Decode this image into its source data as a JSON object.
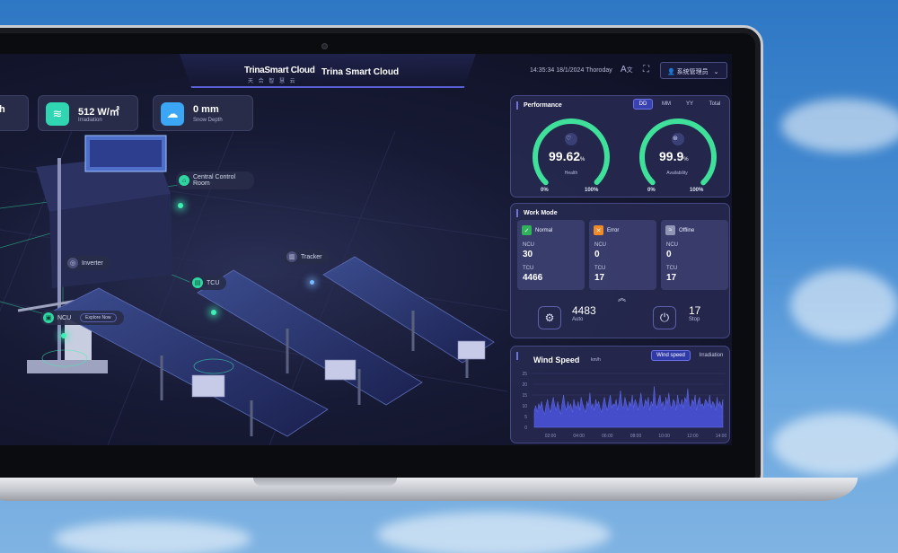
{
  "header": {
    "logo_text": "TrinaSmart Cloud",
    "logo_sub": "天 合 智 慧 云",
    "title": "Trina Smart Cloud",
    "datetime": "14:35:34 18/1/2024 Thoroday",
    "user": "系统管理员",
    "icons": [
      "translate-icon",
      "fullscreen-icon",
      "user-icon",
      "chevron-down-icon"
    ]
  },
  "stats": [
    {
      "value": "h",
      "label": ""
    },
    {
      "value": "512 W/㎡",
      "label": "Irradiation",
      "color": "#2fd6b1"
    },
    {
      "value": "0 mm",
      "label": "Snow Depth",
      "color": "#3aa6f5"
    }
  ],
  "scene": {
    "central": "Central Control Room",
    "inverter": "Inverter",
    "tracker": "Tracker",
    "tcu": "TCU",
    "ncu": "NCU",
    "explore": "Explore Now"
  },
  "performance": {
    "title": "Performance",
    "tabs": [
      "DD",
      "MM",
      "YY",
      "Total"
    ],
    "active_tab": "DD",
    "gauges": [
      {
        "value": "99.62",
        "unit": "%",
        "label": "Health",
        "min": "0%",
        "max": "100%",
        "fraction": 0.9962
      },
      {
        "value": "99.9",
        "unit": "%",
        "label": "Availability",
        "min": "0%",
        "max": "100%",
        "fraction": 0.999
      }
    ]
  },
  "work_mode": {
    "title": "Work Mode",
    "cards": [
      {
        "name": "Normal",
        "color": "#2fb35a",
        "ncu_label": "NCU",
        "ncu": "30",
        "tcu_label": "TCU",
        "tcu": "4466"
      },
      {
        "name": "Error",
        "color": "#f08a26",
        "ncu_label": "NCU",
        "ncu": "0",
        "tcu_label": "TCU",
        "tcu": "17"
      },
      {
        "name": "Offline",
        "color": "#8f95b5",
        "ncu_label": "NCU",
        "ncu": "0",
        "tcu_label": "TCU",
        "tcu": "17"
      }
    ],
    "auto_value": "4483",
    "auto_label": "Auto",
    "stop_value": "17",
    "stop_label": "Stop"
  },
  "wind": {
    "title": "Wind Speed",
    "unit": "km/h",
    "tabs": [
      "Wind speed",
      "Irradiation"
    ],
    "active_tab": "Wind speed"
  },
  "chart_data": {
    "type": "area",
    "title": "Wind Speed",
    "ylabel": "km/h",
    "ylim": [
      0,
      25
    ],
    "yticks": [
      0,
      5,
      10,
      15,
      20,
      25
    ],
    "xticks": [
      "02:00",
      "04:00",
      "06:00",
      "08:00",
      "10:00",
      "12:00",
      "14:00"
    ],
    "series": [
      {
        "color": "#4b55e0",
        "values": [
          8,
          10,
          7,
          11,
          9,
          12,
          8,
          6,
          10,
          13,
          9,
          7,
          11,
          14,
          10,
          8,
          12,
          9,
          6,
          11,
          15,
          10,
          8,
          12,
          9,
          11,
          7,
          13,
          10,
          9,
          12,
          8,
          14,
          11,
          9,
          7,
          12,
          10,
          16,
          9,
          11,
          8,
          13,
          10,
          12,
          9,
          7,
          11,
          14,
          10,
          8,
          12,
          15,
          9,
          11,
          10,
          13,
          8,
          12,
          17,
          10,
          9,
          14,
          11,
          8,
          12,
          10,
          15,
          9,
          13,
          11,
          8,
          12,
          16,
          10,
          9,
          13,
          11,
          14,
          8,
          12,
          10,
          19,
          11,
          9,
          13,
          15,
          10,
          12,
          8,
          14,
          11,
          16,
          10,
          9,
          13,
          12,
          8,
          15,
          11,
          10,
          13,
          9,
          14,
          12,
          18,
          10,
          9,
          13,
          11,
          15,
          8,
          12,
          14,
          10,
          11,
          9,
          13,
          12,
          10,
          15,
          9,
          12,
          11,
          8,
          14,
          10,
          12,
          9,
          13
        ]
      }
    ]
  }
}
